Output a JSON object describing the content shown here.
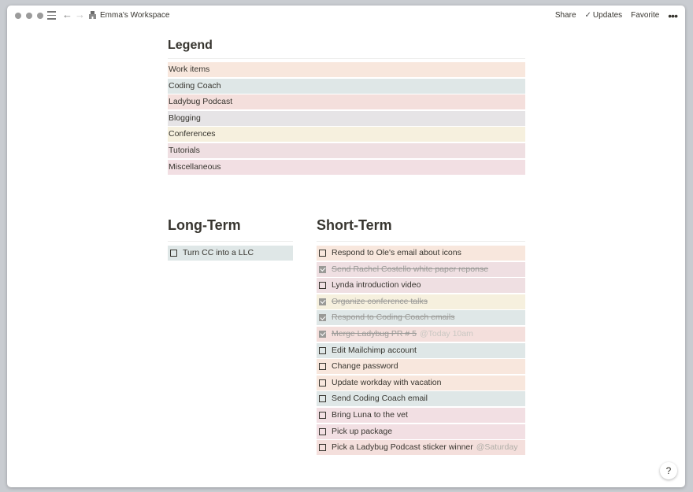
{
  "topbar": {
    "workspace_title": "Emma's Workspace",
    "share_label": "Share",
    "updates_label": "Updates",
    "favorite_label": "Favorite",
    "more_label": "•••"
  },
  "colors": {
    "work": "#f8e7dd",
    "coding_coach": "#dfe7e7",
    "ladybug": "#f4dfdc",
    "blogging": "#e6e4e6",
    "conferences": "#f6f0de",
    "tutorials": "#efdfe2",
    "misc": "#f2dfe3"
  },
  "legend": {
    "title": "Legend",
    "items": [
      {
        "label": "Work items",
        "color": "#f8e7dd"
      },
      {
        "label": "Coding Coach",
        "color": "#dfe7e7"
      },
      {
        "label": "Ladybug Podcast",
        "color": "#f4dfdc"
      },
      {
        "label": "Blogging",
        "color": "#e6e4e6"
      },
      {
        "label": "Conferences",
        "color": "#f6f0de"
      },
      {
        "label": "Tutorials",
        "color": "#efdfe2"
      },
      {
        "label": "Miscellaneous",
        "color": "#f2dfe3"
      }
    ]
  },
  "long_term": {
    "title": "Long-Term",
    "items": [
      {
        "text": "Turn CC into a LLC",
        "done": false,
        "color": "#dfe7e7"
      }
    ]
  },
  "short_term": {
    "title": "Short-Term",
    "items": [
      {
        "text": "Respond to Ole's email about icons",
        "done": false,
        "color": "#f8e7dd"
      },
      {
        "text": "Send Rachel Costello white paper reponse",
        "done": true,
        "color": "#efdfe2"
      },
      {
        "text": "Lynda introduction video",
        "done": false,
        "color": "#efdfe2"
      },
      {
        "text": "Organize conference talks",
        "done": true,
        "color": "#f6f0de"
      },
      {
        "text": "Respond to Coding Coach emails",
        "done": true,
        "color": "#dfe7e7"
      },
      {
        "text": "Merge Ladybug PR # 5",
        "done": true,
        "mention": "@Today 10am",
        "color": "#f4dfdc"
      },
      {
        "text": "Edit Mailchimp account",
        "done": false,
        "color": "#dfe7e7"
      },
      {
        "text": "Change password",
        "done": false,
        "color": "#f8e7dd"
      },
      {
        "text": "Update workday with vacation",
        "done": false,
        "color": "#f8e7dd"
      },
      {
        "text": "Send Coding Coach email",
        "done": false,
        "color": "#dfe7e7"
      },
      {
        "text": "Bring Luna to the vet",
        "done": false,
        "color": "#f2dfe3"
      },
      {
        "text": "Pick up package",
        "done": false,
        "color": "#f2dfe3"
      },
      {
        "text": "Pick a Ladybug Podcast sticker winner",
        "done": false,
        "mention": "@Saturday",
        "color": "#f4dfdc"
      }
    ]
  },
  "help": {
    "label": "?"
  }
}
